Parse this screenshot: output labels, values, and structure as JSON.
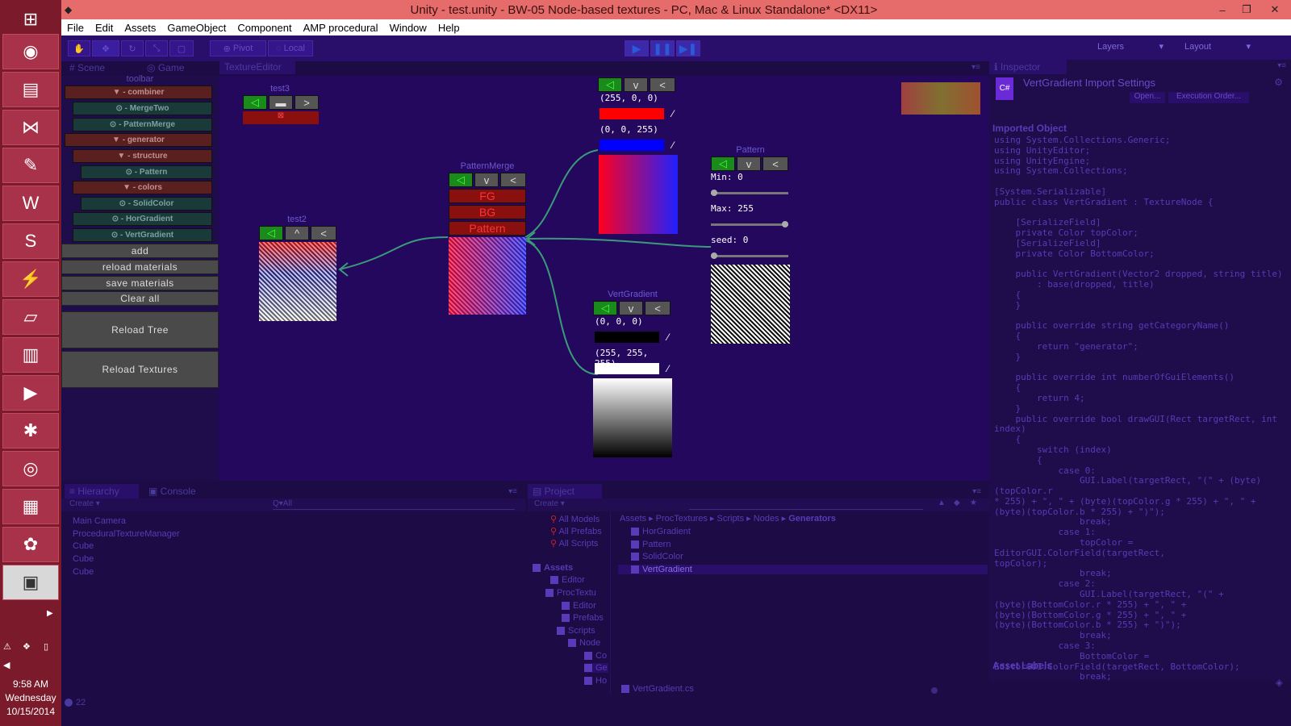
{
  "window": {
    "title": "Unity - test.unity - BW-05 Node-based textures - PC, Mac & Linux Standalone* <DX11>"
  },
  "taskbar": {
    "icons": [
      "windows-start-icon",
      "chrome-icon",
      "file-explorer-icon",
      "visual-studio-icon",
      "gimp-icon",
      "word-icon",
      "skype-icon",
      "thunderbolt-icon",
      "notepad-icon",
      "winrar-icon",
      "media-player-icon",
      "network-icon",
      "steam-icon",
      "calculator-icon",
      "paint-icon",
      "unity-icon"
    ],
    "clock": {
      "time": "9:58 AM",
      "day": "Wednesday",
      "date": "10/15/2014"
    }
  },
  "menu": [
    "File",
    "Edit",
    "Assets",
    "GameObject",
    "Component",
    "AMP procedural",
    "Window",
    "Help"
  ],
  "toolbar": {
    "pivot": "Pivot",
    "local": "Local",
    "layers": "Layers",
    "layout": "Layout"
  },
  "tabs": {
    "scene": "Scene",
    "game": "Game",
    "texture_editor": "TextureEditor",
    "inspector": "Inspector",
    "hierarchy": "Hierarchy",
    "console": "Console",
    "project": "Project"
  },
  "left_panel": {
    "toolbar_label": "toolbar",
    "tree": [
      {
        "label": "▼ - combiner",
        "kind": "cat"
      },
      {
        "label": "⊙ - MergeTwo",
        "kind": "leaf"
      },
      {
        "label": "⊙ - PatternMerge",
        "kind": "leaf"
      },
      {
        "label": "▼ - generator",
        "kind": "cat"
      },
      {
        "label": "▼ - structure",
        "kind": "cat"
      },
      {
        "label": "⊙ - Pattern",
        "kind": "leaf"
      },
      {
        "label": "▼ - colors",
        "kind": "cat"
      },
      {
        "label": "⊙ - SolidColor",
        "kind": "leaf"
      },
      {
        "label": "⊙ - HorGradient",
        "kind": "leaf"
      },
      {
        "label": "⊙ - VertGradient",
        "kind": "leaf"
      }
    ],
    "buttons": {
      "add": "add",
      "reload_materials": "reload materials",
      "save_materials": "save materials",
      "clear_all": "Clear all",
      "reload_tree": "Reload Tree",
      "reload_textures": "Reload Textures"
    }
  },
  "nodes": {
    "test3": {
      "title": "test3"
    },
    "test2": {
      "title": "test2"
    },
    "pattern_merge": {
      "title": "PatternMerge",
      "fg": "FG",
      "bg": "BG",
      "pattern": "Pattern"
    },
    "hor_gradient": {
      "color1": "(255, 0, 0)",
      "color2": "(0, 0, 255)"
    },
    "vert_gradient": {
      "title": "VertGradient",
      "color1": "(0, 0, 0)",
      "color2": "(255, 255, 255)"
    },
    "pattern": {
      "title": "Pattern",
      "min_label": "Min: 0",
      "max_label": "Max: 255",
      "seed_label": "seed: 0",
      "min_value": 0,
      "max_value": 255,
      "seed": 0
    }
  },
  "inspector": {
    "title": "VertGradient Import Settings",
    "open": "Open...",
    "execution_order": "Execution Order...",
    "imported_object": "Imported Object",
    "code": "using System.Collections.Generic;\nusing UnityEditor;\nusing UnityEngine;\nusing System.Collections;\n\n[System.Serializable]\npublic class VertGradient : TextureNode {\n\n    [SerializeField]\n    private Color topColor;\n    [SerializeField]\n    private Color BottomColor;\n\n    public VertGradient(Vector2 dropped, string title)\n        : base(dropped, title)\n    {\n    }\n\n    public override string getCategoryName()\n    {\n        return \"generator\";\n    }\n\n    public override int numberOfGuiElements()\n    {\n        return 4;\n    }\n    public override bool drawGUI(Rect targetRect, int\nindex)\n    {\n        switch (index)\n        {\n            case 0:\n                GUI.Label(targetRect, \"(\" + (byte)(topColor.r\n* 255) + \", \" + (byte)(topColor.g * 255) + \", \" +\n(byte)(topColor.b * 255) + \")\");\n                break;\n            case 1:\n                topColor = EditorGUI.ColorField(targetRect,\ntopColor);\n                break;\n            case 2:\n                GUI.Label(targetRect, \"(\" +\n(byte)(BottomColor.r * 255) + \", \" +\n(byte)(BottomColor.g * 255) + \", \" +\n(byte)(BottomColor.b * 255) + \")\");\n                break;\n            case 3:\n                BottomColor =\nEditorGUI.ColorField(targetRect, BottomColor);\n                break;",
    "asset_labels": "Asset Labels"
  },
  "hierarchy": {
    "create": "Create ▾",
    "search": "Q▾All",
    "items": [
      "Main Camera",
      "ProceduralTextureManager",
      "Cube",
      "Cube",
      "Cube"
    ]
  },
  "project": {
    "create": "Create ▾",
    "favorites": [
      "All Models",
      "All Prefabs",
      "All Scripts"
    ],
    "tree": [
      "Assets",
      "Editor",
      "ProcTextu",
      "Editor",
      "Prefabs",
      "Scripts",
      "Node",
      "Co",
      "Ge",
      "Ho"
    ],
    "breadcrumb": [
      "Assets",
      "ProcTextures",
      "Scripts",
      "Nodes",
      "Generators"
    ],
    "files": [
      "HorGradient",
      "Pattern",
      "SolidColor",
      "VertGradient"
    ],
    "selected_file": "VertGradient.cs"
  },
  "status": {
    "count": "22"
  }
}
